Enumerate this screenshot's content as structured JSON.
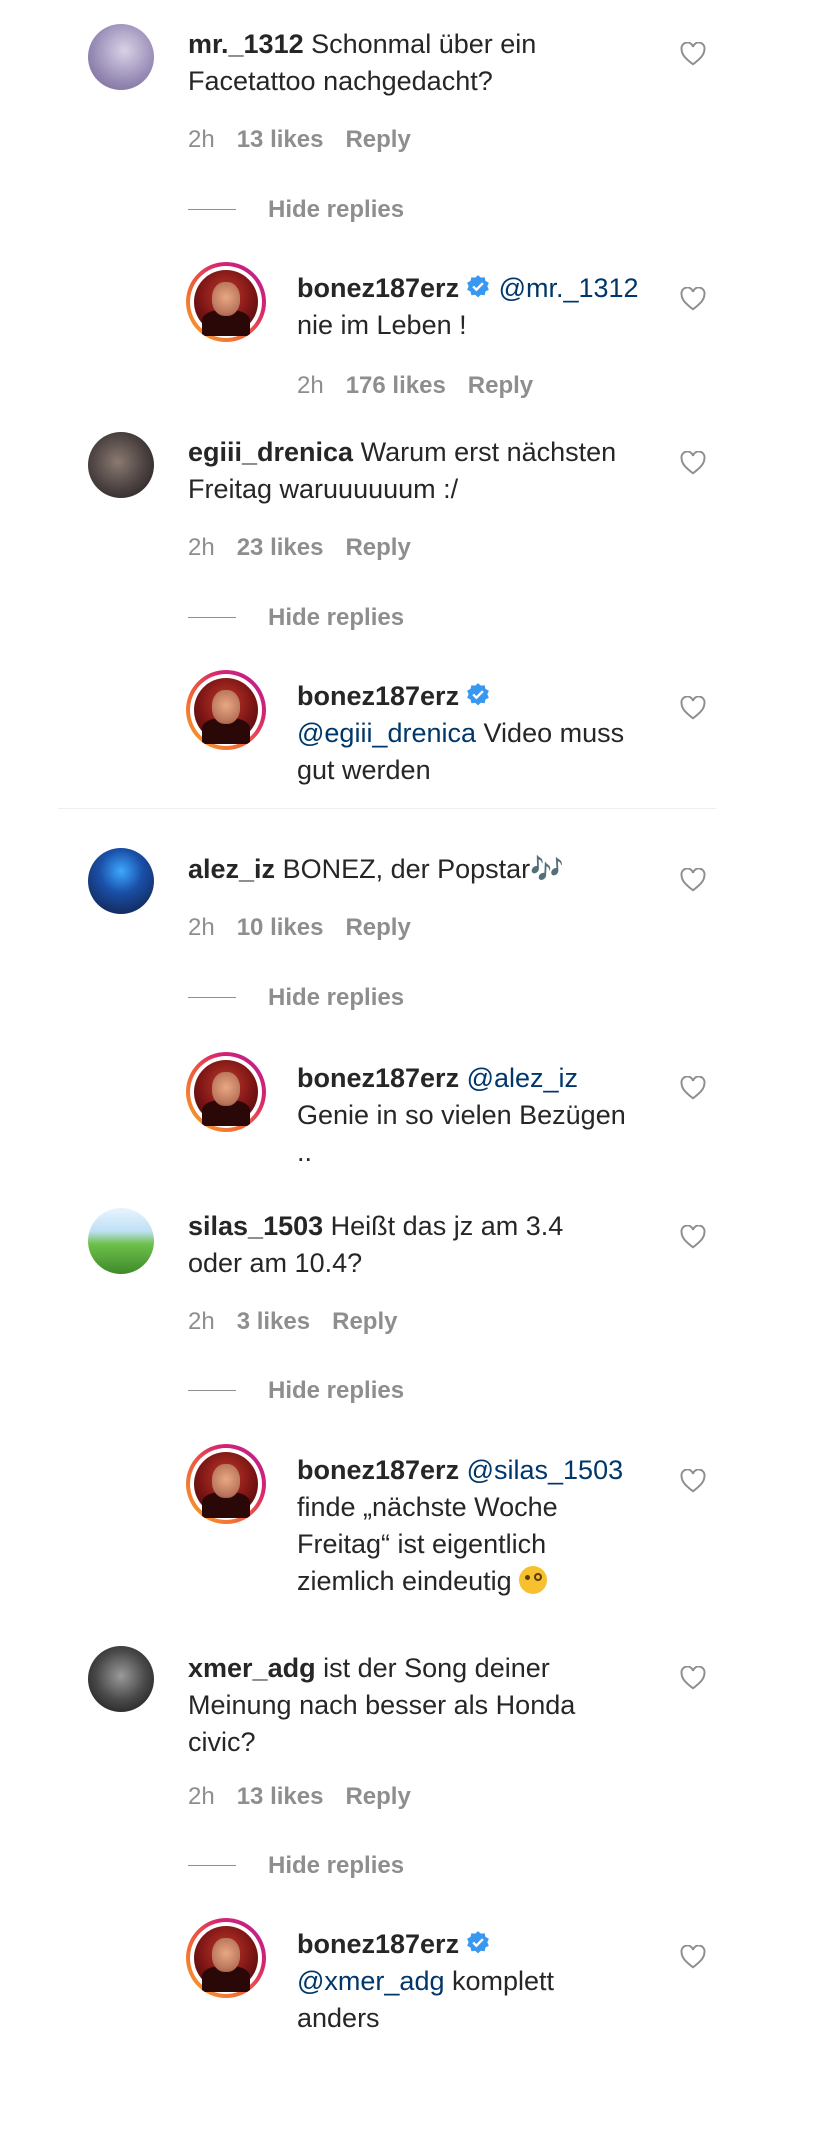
{
  "comments": [
    {
      "user": "mr._1312",
      "text_line1": "Schonmal über ein",
      "text_line2": "Facetattoo nachgedacht?",
      "time": "2h",
      "likes": "13 likes",
      "reply": "Reply",
      "hide_replies": "Hide replies",
      "avatar_color": "#9b8fb8",
      "reply_comment": {
        "user": "bonez187erz",
        "mention": "@mr._1312",
        "line1": "nie im Leben !",
        "time": "2h",
        "likes": "176 likes",
        "reply": "Reply"
      }
    },
    {
      "user": "egiii_drenica",
      "text_line1": "Warum erst nächsten",
      "text_line2": "Freitag waruuuuuum :/",
      "time": "2h",
      "likes": "23 likes",
      "reply": "Reply",
      "hide_replies": "Hide replies",
      "avatar_color": "#4a4040",
      "reply_comment": {
        "user": "bonez187erz",
        "mention": "@egiii_drenica",
        "line1": "Video muss",
        "line2": "gut werden"
      }
    },
    {
      "user": "alez_iz",
      "text_line1": "BONEZ, der Popstar🎶",
      "time": "2h",
      "likes": "10 likes",
      "reply": "Reply",
      "hide_replies": "Hide replies",
      "avatar_color": "#1a2a55",
      "reply_comment": {
        "user": "bonez187erz",
        "mention": "@alez_iz",
        "line1": "Genie in so vielen Bezügen",
        "line2": ".."
      }
    },
    {
      "user": "silas_1503",
      "text_line1": "Heißt das jz am 3.4",
      "text_line2": "oder am 10.4?",
      "time": "2h",
      "likes": "3 likes",
      "reply": "Reply",
      "hide_replies": "Hide replies",
      "avatar_color": "#5fae4a",
      "reply_comment": {
        "user": "bonez187erz",
        "mention": "@silas_1503",
        "line1": "finde „nächste Woche",
        "line2": "Freitag“ ist eigentlich",
        "line3": "ziemlich eindeutig"
      }
    },
    {
      "user": "xmer_adg",
      "text_line1": "ist der Song deiner",
      "text_line2": "Meinung nach besser als Honda",
      "text_line3": "civic?",
      "time": "2h",
      "likes": "13 likes",
      "reply": "Reply",
      "hide_replies": "Hide replies",
      "avatar_color": "#3a3a3a",
      "reply_comment": {
        "user": "bonez187erz",
        "mention": "@xmer_adg",
        "line1": "komplett",
        "line2": "anders"
      }
    }
  ],
  "colors": {
    "mention": "#00376b",
    "muted": "#8e8e8e",
    "verified": "#3897f0"
  },
  "icons": {
    "like": "heart-outline-icon",
    "verified": "verified-badge-icon",
    "emoji": "monocle-face-emoji"
  }
}
